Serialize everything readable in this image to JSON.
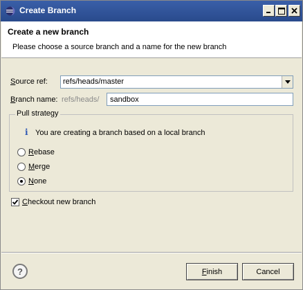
{
  "window": {
    "title": "Create Branch",
    "controls": {
      "minimize": "minimize-icon",
      "maximize": "maximize-icon",
      "close": "close-icon"
    }
  },
  "header": {
    "title": "Create a new branch",
    "subtitle": "Please choose a source branch and a name for the new branch"
  },
  "form": {
    "source_ref": {
      "label_first": "S",
      "label_rest": "ource ref:",
      "value": "refs/heads/master"
    },
    "branch_name": {
      "label_first": "B",
      "label_rest": "ranch name:",
      "prefix": "refs/heads/",
      "value": "sandbox"
    }
  },
  "pull_strategy": {
    "legend": "Pull strategy",
    "info": "You are creating a branch based on a local branch",
    "options": [
      {
        "first": "R",
        "rest": "ebase",
        "selected": false
      },
      {
        "first": "M",
        "rest": "erge",
        "selected": false
      },
      {
        "first": "N",
        "rest": "one",
        "selected": true
      }
    ]
  },
  "checkout": {
    "first": "C",
    "rest": "heckout new branch",
    "checked": true
  },
  "buttons": {
    "help": "?",
    "finish_first": "F",
    "finish_rest": "inish",
    "cancel": "Cancel"
  },
  "colors": {
    "titlebar": "#294a8c",
    "dialog_bg": "#ece9d8",
    "info_icon": "#2d57b4"
  }
}
